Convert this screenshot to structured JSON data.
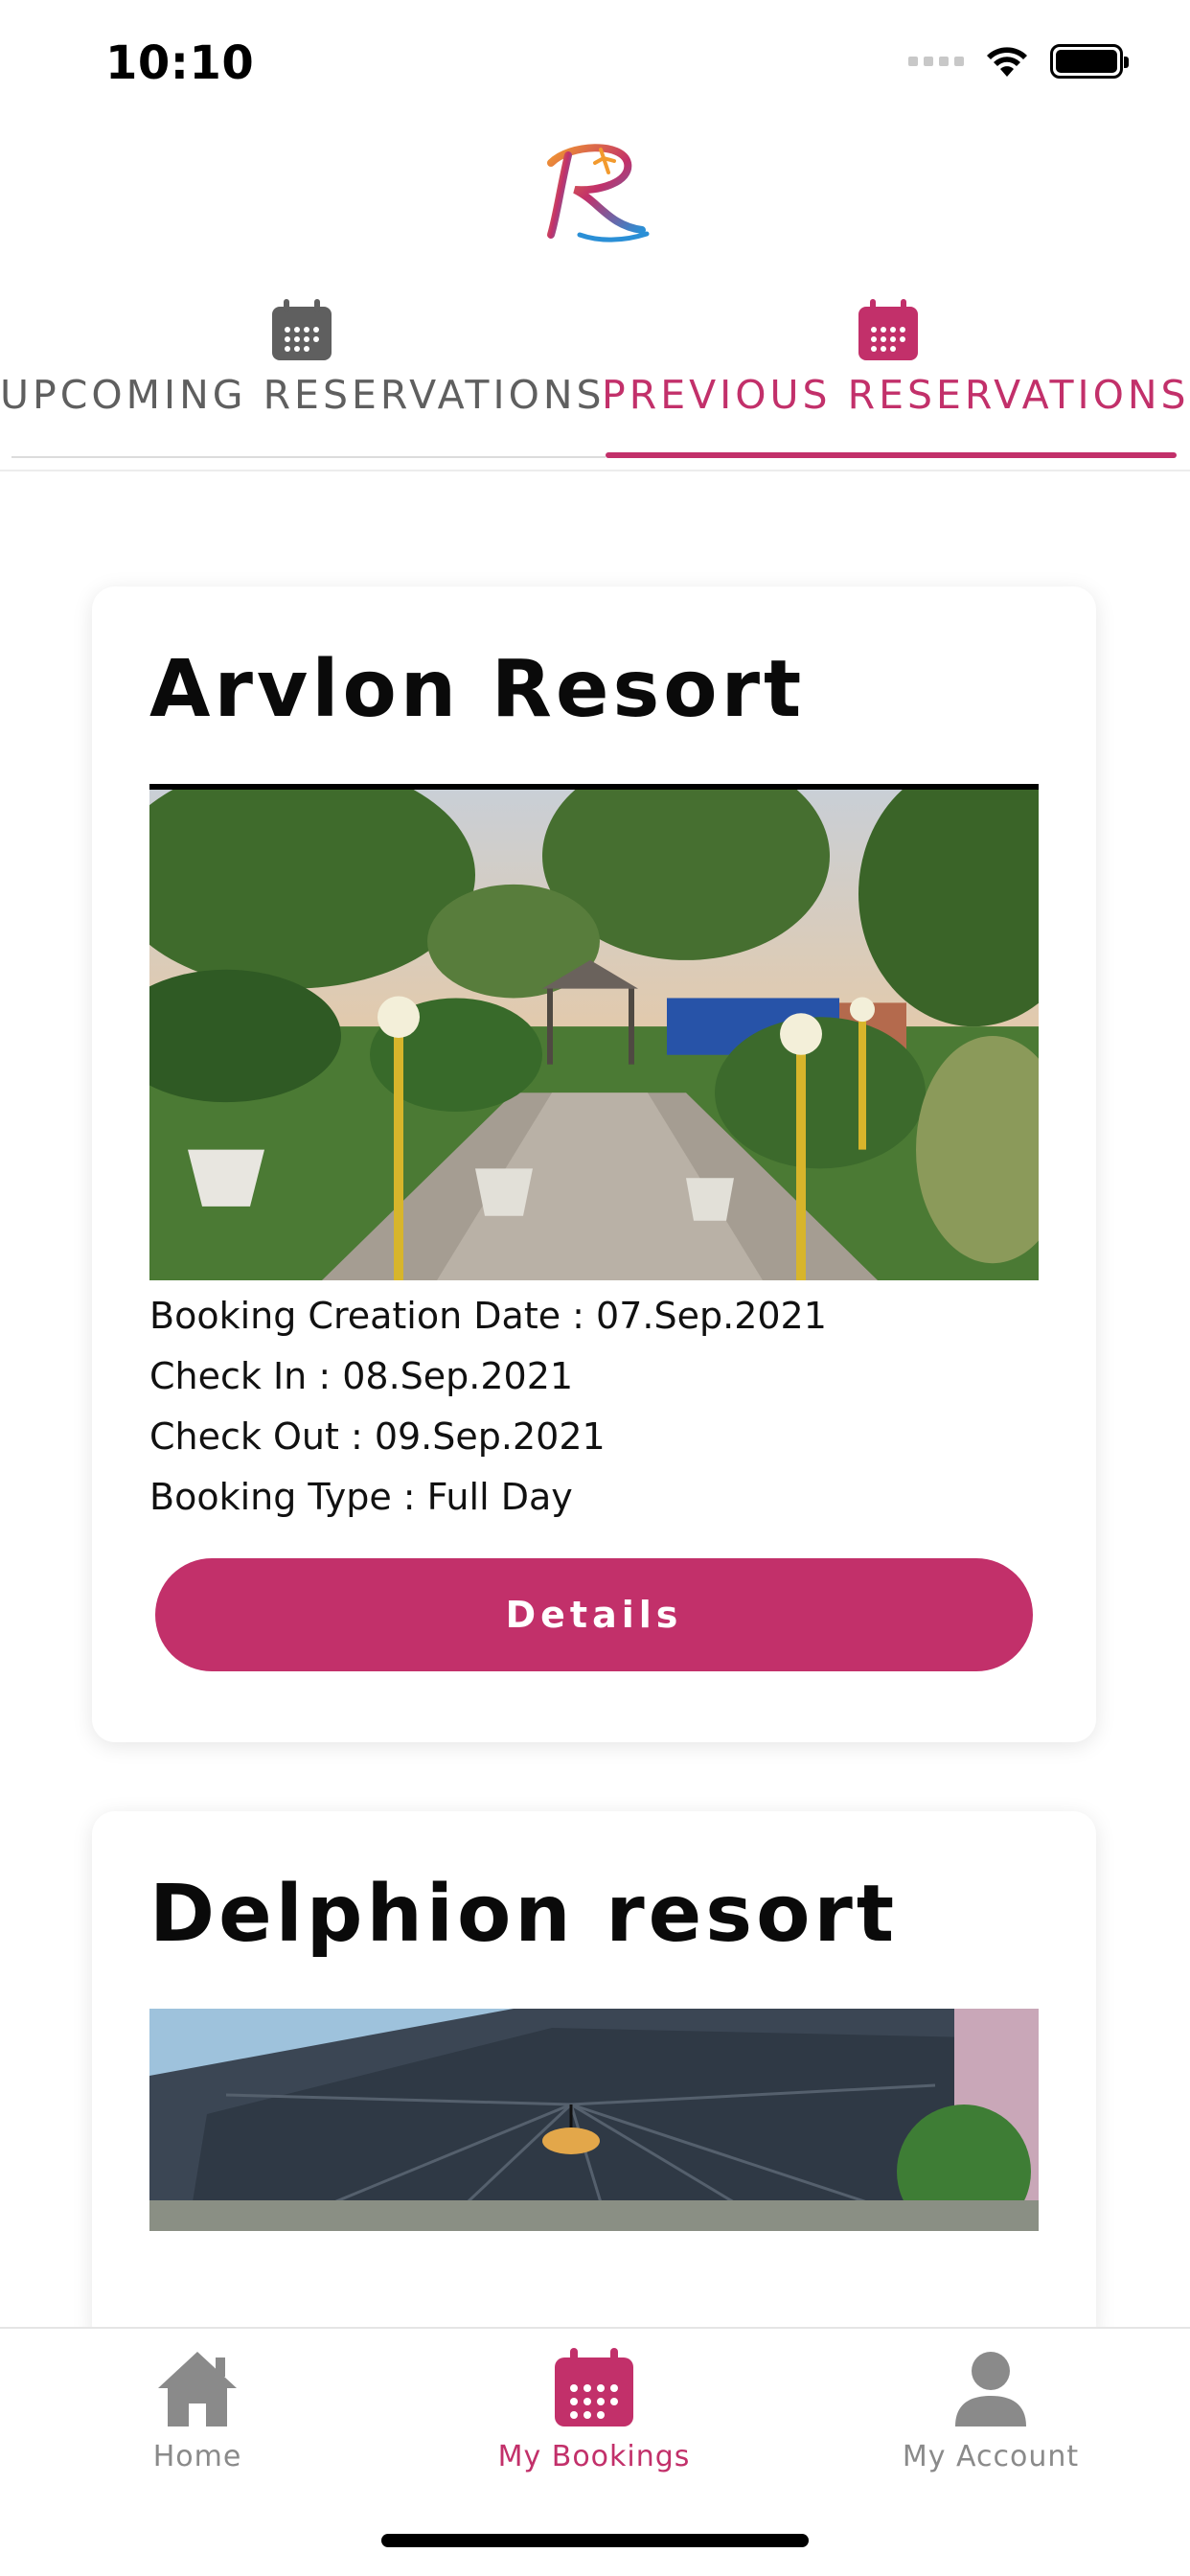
{
  "status_bar": {
    "time": "10:10"
  },
  "logo": {
    "name": "resort-logo"
  },
  "tabs": [
    {
      "label": "UPCOMING RESERVATIONS",
      "icon": "calendar-icon",
      "active": false
    },
    {
      "label": "PREVIOUS RESERVATIONS",
      "icon": "calendar-icon",
      "active": true
    }
  ],
  "colors": {
    "accent": "#c2306a",
    "inactive": "#8a8a8a",
    "card_bg": "#ffffff"
  },
  "reservations": [
    {
      "title": "Arvlon Resort",
      "creation_date": "Booking Creation Date : 07.Sep.2021",
      "check_in": "Check In : 08.Sep.2021",
      "check_out": "Check Out : 09.Sep.2021",
      "booking_type": "Booking Type : Full Day",
      "button_label": "Details"
    },
    {
      "title": "Delphion resort"
    }
  ],
  "bottom_nav": [
    {
      "label": "Home",
      "icon": "home-icon",
      "active": false
    },
    {
      "label": "My Bookings",
      "icon": "calendar-icon",
      "active": true
    },
    {
      "label": "My Account",
      "icon": "user-icon",
      "active": false
    }
  ]
}
